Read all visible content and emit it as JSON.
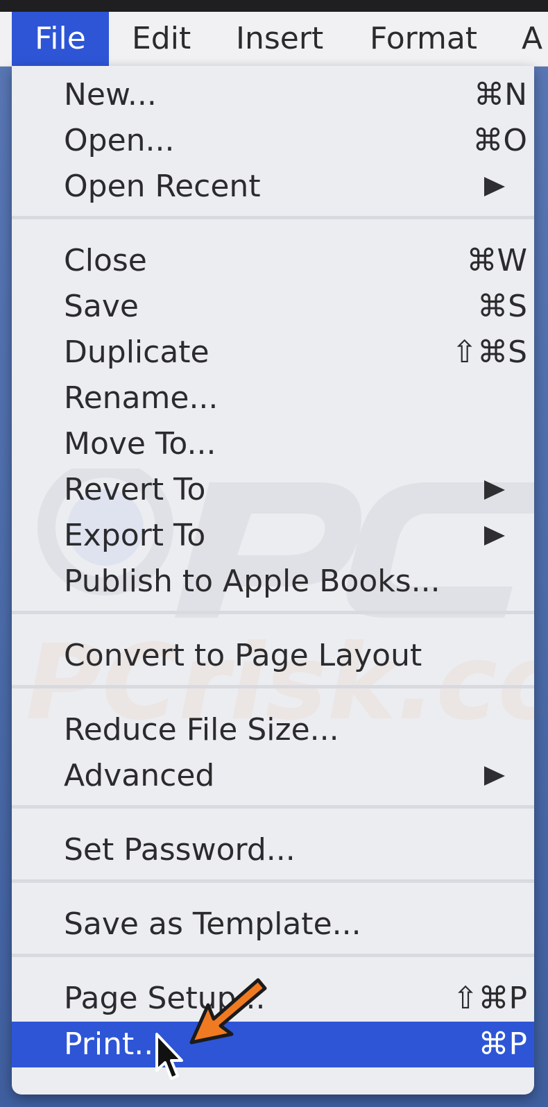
{
  "menubar": {
    "items": [
      {
        "label": "File",
        "active": true
      },
      {
        "label": "Edit",
        "active": false
      },
      {
        "label": "Insert",
        "active": false
      },
      {
        "label": "Format",
        "active": false
      },
      {
        "label": "A",
        "active": false
      }
    ]
  },
  "file_menu": {
    "groups": [
      [
        {
          "label": "New...",
          "shortcut": "⌘N"
        },
        {
          "label": "Open...",
          "shortcut": "⌘O"
        },
        {
          "label": "Open Recent",
          "submenu": true
        }
      ],
      [
        {
          "label": "Close",
          "shortcut": "⌘W"
        },
        {
          "label": "Save",
          "shortcut": "⌘S"
        },
        {
          "label": "Duplicate",
          "shortcut": "⇧⌘S"
        },
        {
          "label": "Rename..."
        },
        {
          "label": "Move To..."
        },
        {
          "label": "Revert To",
          "submenu": true
        },
        {
          "label": "Export To",
          "submenu": true
        },
        {
          "label": "Publish to Apple Books..."
        }
      ],
      [
        {
          "label": "Convert to Page Layout"
        }
      ],
      [
        {
          "label": "Reduce File Size..."
        },
        {
          "label": "Advanced",
          "submenu": true
        }
      ],
      [
        {
          "label": "Set Password..."
        }
      ],
      [
        {
          "label": "Save as Template..."
        }
      ],
      [
        {
          "label": "Page Setup...",
          "shortcut": "⇧⌘P"
        },
        {
          "label": "Print...",
          "shortcut": "⌘P",
          "highlighted": true
        }
      ]
    ]
  },
  "watermark_text": "PCrisk.com",
  "colors": {
    "menu_background": "#ecedf1",
    "highlight": "#2d55d6",
    "text": "#2b2b2d",
    "separator": "#d9dadf",
    "menubar_background": "#f1f1f3",
    "annotation_arrow": "#f07a22",
    "desktop": "#4d6fae"
  },
  "icons": [
    "submenu-triangle-icon",
    "orange-pointer-arrow-icon",
    "mouse-cursor-icon"
  ]
}
